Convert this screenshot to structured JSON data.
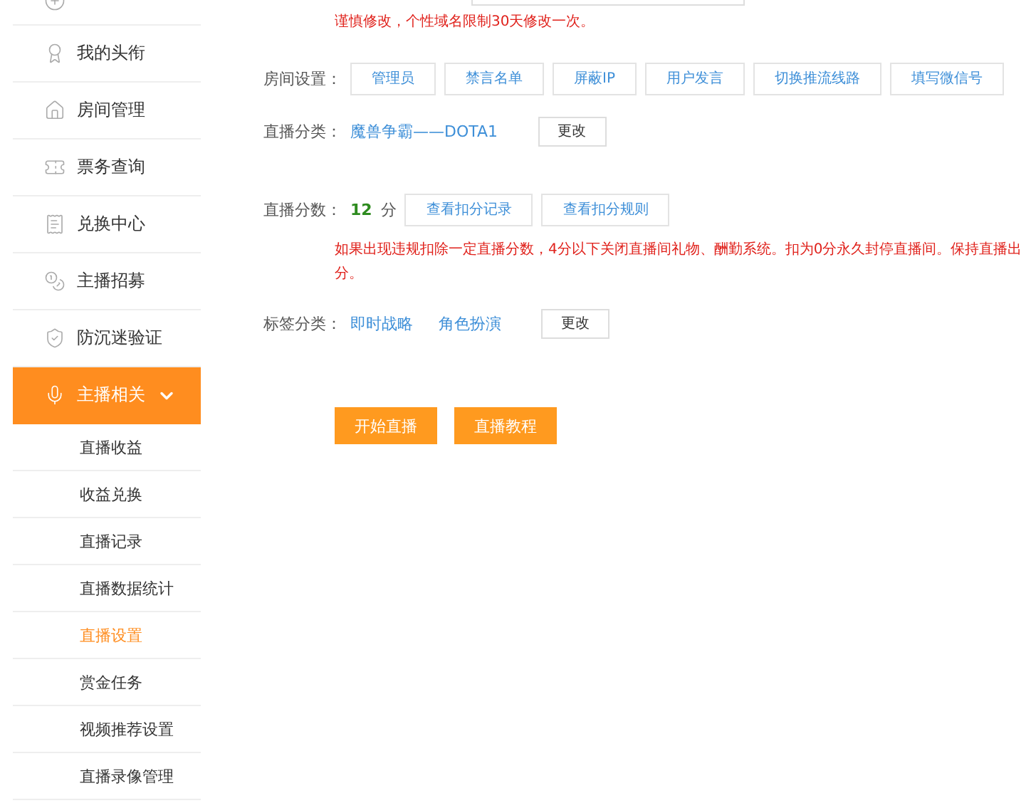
{
  "sidebar": {
    "items": [
      {
        "label": "我的头衔",
        "selected": false
      },
      {
        "label": "房间管理",
        "selected": false
      },
      {
        "label": "票务查询",
        "selected": false
      },
      {
        "label": "兑换中心",
        "selected": false
      },
      {
        "label": "主播招募",
        "selected": false
      },
      {
        "label": "防沉迷验证",
        "selected": false
      },
      {
        "label": "主播相关",
        "selected": true,
        "expanded": true,
        "children": [
          {
            "label": "直播收益",
            "selected": false
          },
          {
            "label": "收益兑换",
            "selected": false
          },
          {
            "label": "直播记录",
            "selected": false
          },
          {
            "label": "直播数据统计",
            "selected": false
          },
          {
            "label": "直播设置",
            "selected": true
          },
          {
            "label": "赏金任务",
            "selected": false
          },
          {
            "label": "视频推荐设置",
            "selected": false
          },
          {
            "label": "直播录像管理",
            "selected": false
          }
        ]
      }
    ]
  },
  "domain_note": "谨慎修改，个性域名限制30天修改一次。",
  "room_settings": {
    "label": "房间设置：",
    "buttons": [
      "管理员",
      "禁言名单",
      "屏蔽IP",
      "用户发言",
      "切换推流线路",
      "填写微信号"
    ]
  },
  "category": {
    "label": "直播分类：",
    "value": "魔兽争霸——DOTA1",
    "button": "更改"
  },
  "score": {
    "label": "直播分数：",
    "value": "12",
    "unit": "分",
    "buttons": [
      "查看扣分记录",
      "查看扣分规则"
    ],
    "note_lines": [
      "如果出现违规扣除一定直播分数，4分以下关闭直播间礼物、酬勤系统。扣为0分永久封停直播间。保持直播出",
      "分。"
    ]
  },
  "tags": {
    "label": "标签分类：",
    "values": [
      "即时战略",
      "角色扮演"
    ],
    "button": "更改"
  },
  "actions": [
    "开始直播",
    "直播教程"
  ]
}
